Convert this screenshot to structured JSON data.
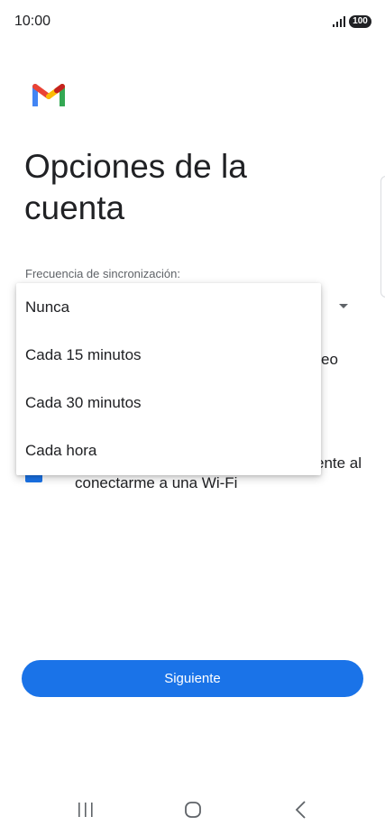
{
  "status_bar": {
    "time": "10:00",
    "signal_icon": "signal-bars-icon",
    "battery_level": "100"
  },
  "header": {
    "logo_icon": "gmail-logo-icon",
    "title": "Opciones de la cuenta"
  },
  "sync": {
    "label": "Frecuencia de sincronización:",
    "dropdown_icon": "dropdown-arrow-icon",
    "options": [
      "Nunca",
      "Cada 15 minutos",
      "Cada 30 minutos",
      "Cada hora"
    ]
  },
  "background_fragments": {
    "video_tail": "eo",
    "auto_tail": "ente al",
    "wifi_line": "conectarme a una Wi-Fi"
  },
  "actions": {
    "next_label": "Siguiente"
  },
  "colors": {
    "accent": "#1a73e8",
    "text_primary": "#202124",
    "text_secondary": "#5f6368"
  },
  "nav_bar": {
    "icons": [
      "recent-apps-icon",
      "home-icon",
      "back-icon"
    ]
  }
}
